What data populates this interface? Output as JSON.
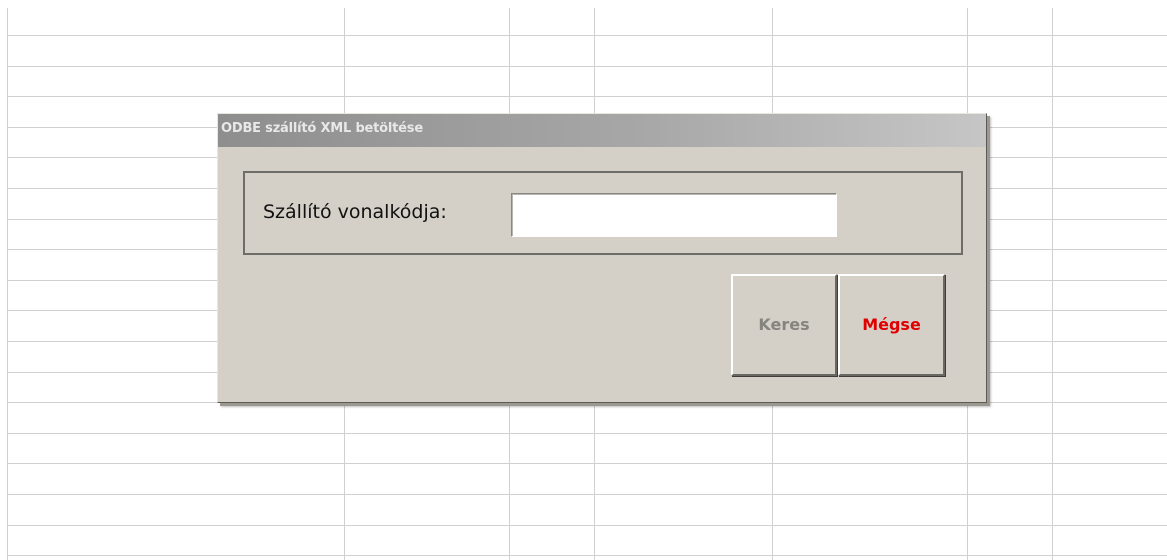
{
  "dialog": {
    "title": "ODBE szállító XML betöltése",
    "field_label": "Szállító vonalkódja:",
    "field_value": "",
    "search_label": "Keres",
    "cancel_label": "Mégse"
  },
  "colors": {
    "dialog_background": "#d4d0c8",
    "titlebar_start": "#8e8e8e",
    "titlebar_end": "#c6c6c6",
    "cancel_text": "#e00000",
    "disabled_text": "#86847f"
  },
  "icons": []
}
